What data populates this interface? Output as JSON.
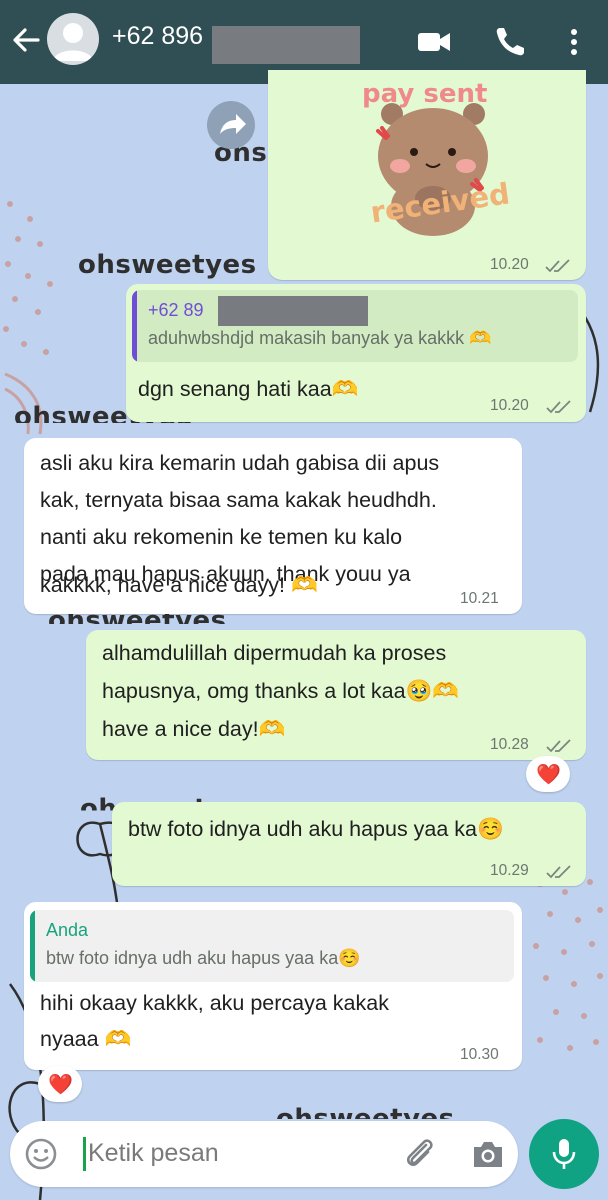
{
  "header": {
    "contact_name": "+62 896",
    "icons": [
      "back-arrow-icon",
      "avatar",
      "video-call-icon",
      "phone-icon",
      "more-vert-icon"
    ]
  },
  "wallpaper": {
    "watermark_text": "ohsweetyes",
    "watermark_fragment": "ohs",
    "accent_color": "#c49a9a"
  },
  "sticker": {
    "top_text": "pay sent",
    "bottom_text": "received",
    "time": "10.20"
  },
  "messages": [
    {
      "id": "m2",
      "direction": "out",
      "quote_name": "+62 89",
      "quote_text": "aduhwbshdjd makasih banyak ya kakkk 🫶",
      "text": "dgn senang hati kaa🫶",
      "time": "10.20"
    },
    {
      "id": "m3",
      "direction": "in",
      "lines": [
        "asli aku kira kemarin udah gabisa dii apus",
        "kak, ternyata bisaa sama kakak heudhdh.",
        "nanti aku rekomenin ke temen ku kalo",
        "pada mau hapus akuun. thank youu ya",
        "kakkkk, have a nice dayy! 🫶"
      ],
      "time": "10.21"
    },
    {
      "id": "m4",
      "direction": "out",
      "lines": [
        "alhamdulillah dipermudah ka proses",
        "hapusnya, omg thanks a lot kaa🥹🫶",
        "have a nice day!🫶"
      ],
      "time": "10.28",
      "reaction": "❤️"
    },
    {
      "id": "m5",
      "direction": "out",
      "text": "btw foto idnya udh aku hapus yaa ka☺️",
      "time": "10.29"
    },
    {
      "id": "m6",
      "direction": "in",
      "quote_name": "Anda",
      "quote_text": "btw foto idnya udh aku hapus yaa ka☺️",
      "lines": [
        "hihi okaay kakkk, aku percaya kakak",
        "nyaaa 🫶"
      ],
      "time": "10.30",
      "reaction": "❤️"
    }
  ],
  "composer": {
    "placeholder": "Ketik pesan",
    "icons": [
      "emoji-icon",
      "attach-icon",
      "camera-icon",
      "mic-icon"
    ]
  }
}
